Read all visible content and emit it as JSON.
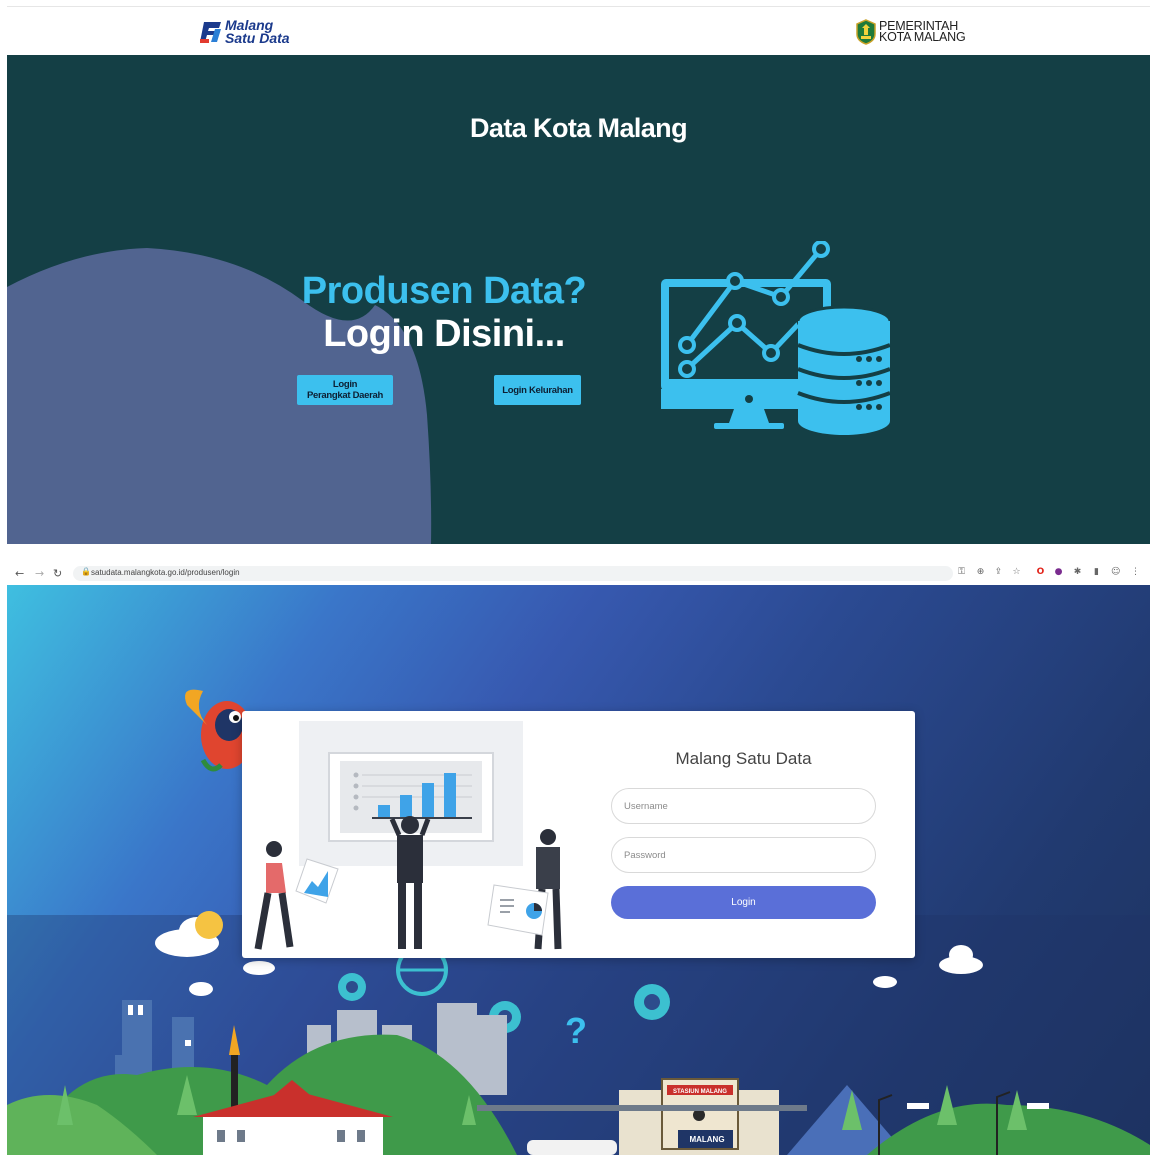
{
  "top": {
    "logo_left": {
      "line1": "Malang",
      "line2": "Satu Data"
    },
    "logo_right": {
      "line1": "PEMERINTAH",
      "line2": "KOTA MALANG"
    },
    "hero_title": "Data Kota Malang",
    "question": "Produsen Data?",
    "cta": "Login Disini...",
    "btn_perangkat": {
      "line1": "Login",
      "line2": "Perangkat Daerah"
    },
    "btn_kelurahan": "Login Kelurahan"
  },
  "browser": {
    "url": "satudata.malangkota.go.id/produsen/login",
    "nav_icons": [
      "back-arrow-icon",
      "forward-arrow-icon",
      "reload-icon"
    ],
    "toolbar_icons": [
      "key-icon",
      "zoom-icon",
      "share-icon",
      "star-icon",
      "opera-icon",
      "extension-icon",
      "puzzle-icon",
      "sidepanel-icon",
      "profile-icon",
      "menu-icon"
    ]
  },
  "login": {
    "title": "Malang Satu Data",
    "username_placeholder": "Username",
    "password_placeholder": "Password",
    "button": "Login"
  },
  "scene": {
    "station_sign": "STASIUN MALANG",
    "station_name": "MALANG"
  },
  "colors": {
    "hero_bg": "#143f45",
    "accent_cyan": "#3cc0ee",
    "blob": "#516490",
    "login_button": "#5a6fd8"
  }
}
